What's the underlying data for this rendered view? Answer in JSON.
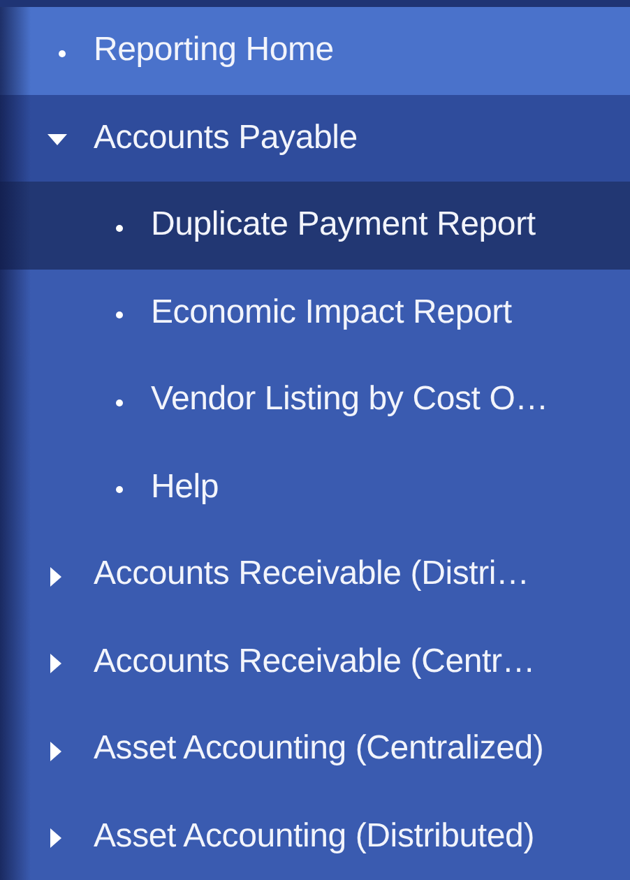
{
  "nav": {
    "items": [
      {
        "label": "Reporting Home",
        "kind": "leaf",
        "selected": false,
        "hovered": true
      },
      {
        "label": "Accounts Payable",
        "kind": "folder",
        "expanded": true,
        "selected": false,
        "hovered": false,
        "children": [
          {
            "label": "Duplicate Payment Report",
            "kind": "leaf",
            "selected": true,
            "hovered": false
          },
          {
            "label": "Economic Impact Report",
            "kind": "leaf",
            "selected": false,
            "hovered": false
          },
          {
            "label": "Vendor Listing by Cost O…",
            "kind": "leaf",
            "selected": false,
            "hovered": false
          },
          {
            "label": "Help",
            "kind": "leaf",
            "selected": false,
            "hovered": false
          }
        ]
      },
      {
        "label": "Accounts Receivable (Distri…",
        "kind": "folder",
        "expanded": false,
        "selected": false,
        "hovered": false
      },
      {
        "label": "Accounts Receivable (Centr…",
        "kind": "folder",
        "expanded": false,
        "selected": false,
        "hovered": false
      },
      {
        "label": "Asset Accounting (Centralized)",
        "kind": "folder",
        "expanded": false,
        "selected": false,
        "hovered": false
      },
      {
        "label": "Asset Accounting (Distributed)",
        "kind": "folder",
        "expanded": false,
        "selected": false,
        "hovered": false
      }
    ]
  }
}
